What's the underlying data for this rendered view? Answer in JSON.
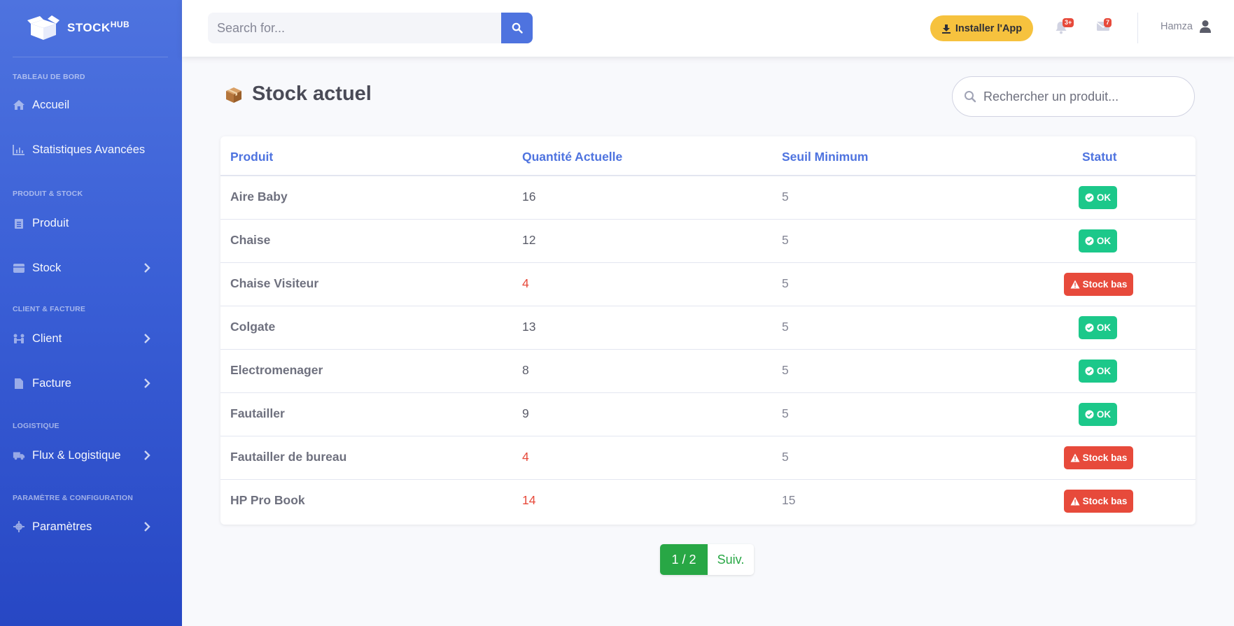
{
  "brand": {
    "name": "STOCK",
    "sup": "HUB"
  },
  "sidebar": {
    "sections": [
      {
        "heading": "TABLEAU DE BORD"
      },
      {
        "heading": "PRODUIT & STOCK"
      },
      {
        "heading": "CLIENT & FACTURE"
      },
      {
        "heading": "LOGISTIQUE"
      },
      {
        "heading": "PARAMÈTRE & CONFIGURATION"
      }
    ],
    "items": [
      {
        "label": "Accueil",
        "icon": "home-icon"
      },
      {
        "label": "Statistiques Avancées",
        "icon": "chart-icon"
      },
      {
        "label": "Produit",
        "icon": "clipboard-icon"
      },
      {
        "label": "Stock",
        "icon": "box-icon"
      },
      {
        "label": "Client",
        "icon": "people-icon"
      },
      {
        "label": "Facture",
        "icon": "file-icon"
      },
      {
        "label": "Flux & Logistique",
        "icon": "truck-icon"
      },
      {
        "label": "Paramètres",
        "icon": "gear-icon"
      }
    ]
  },
  "topbar": {
    "search_placeholder": "Search for...",
    "install_label": "Installer l'App",
    "alerts_count": "3+",
    "messages_count": "7",
    "user_name": "Hamza"
  },
  "main": {
    "title": "Stock actuel",
    "search_placeholder": "Rechercher un produit...",
    "columns": [
      "Produit",
      "Quantité Actuelle",
      "Seuil Minimum",
      "Statut"
    ],
    "rows": [
      {
        "product": "Aire Baby",
        "qty": "16",
        "min": "5",
        "status": "OK",
        "low": false
      },
      {
        "product": "Chaise",
        "qty": "12",
        "min": "5",
        "status": "OK",
        "low": false
      },
      {
        "product": "Chaise Visiteur",
        "qty": "4",
        "min": "5",
        "status": "Stock bas",
        "low": true
      },
      {
        "product": "Colgate",
        "qty": "13",
        "min": "5",
        "status": "OK",
        "low": false
      },
      {
        "product": "Electromenager",
        "qty": "8",
        "min": "5",
        "status": "OK",
        "low": false
      },
      {
        "product": "Fautailler",
        "qty": "9",
        "min": "5",
        "status": "OK",
        "low": false
      },
      {
        "product": "Fautailler de bureau",
        "qty": "4",
        "min": "5",
        "status": "Stock bas",
        "low": true
      },
      {
        "product": "HP Pro Book",
        "qty": "14",
        "min": "15",
        "status": "Stock bas",
        "low": true
      }
    ],
    "pagination": {
      "current": "1 / 2",
      "next": "Suiv."
    }
  },
  "colors": {
    "primary": "#4e73df",
    "success": "#1cc88a",
    "danger": "#e74a3b",
    "warning": "#f6c23e",
    "pager_green": "#28a745"
  }
}
